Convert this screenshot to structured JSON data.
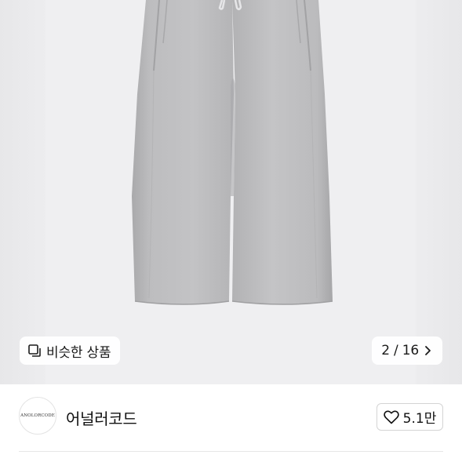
{
  "gallery": {
    "image_alt": "gray wide-leg pintuck sweatpants",
    "similar_label": "비슷한 상품",
    "similar_icon": "similar-items-icon",
    "page_counter": "2 / 16",
    "next_icon": "chevron-right-icon"
  },
  "shop": {
    "logo_text": "ANOLORCODE",
    "name": "어널러코드",
    "like_icon": "heart-outline-icon",
    "like_count": "5.1만"
  }
}
